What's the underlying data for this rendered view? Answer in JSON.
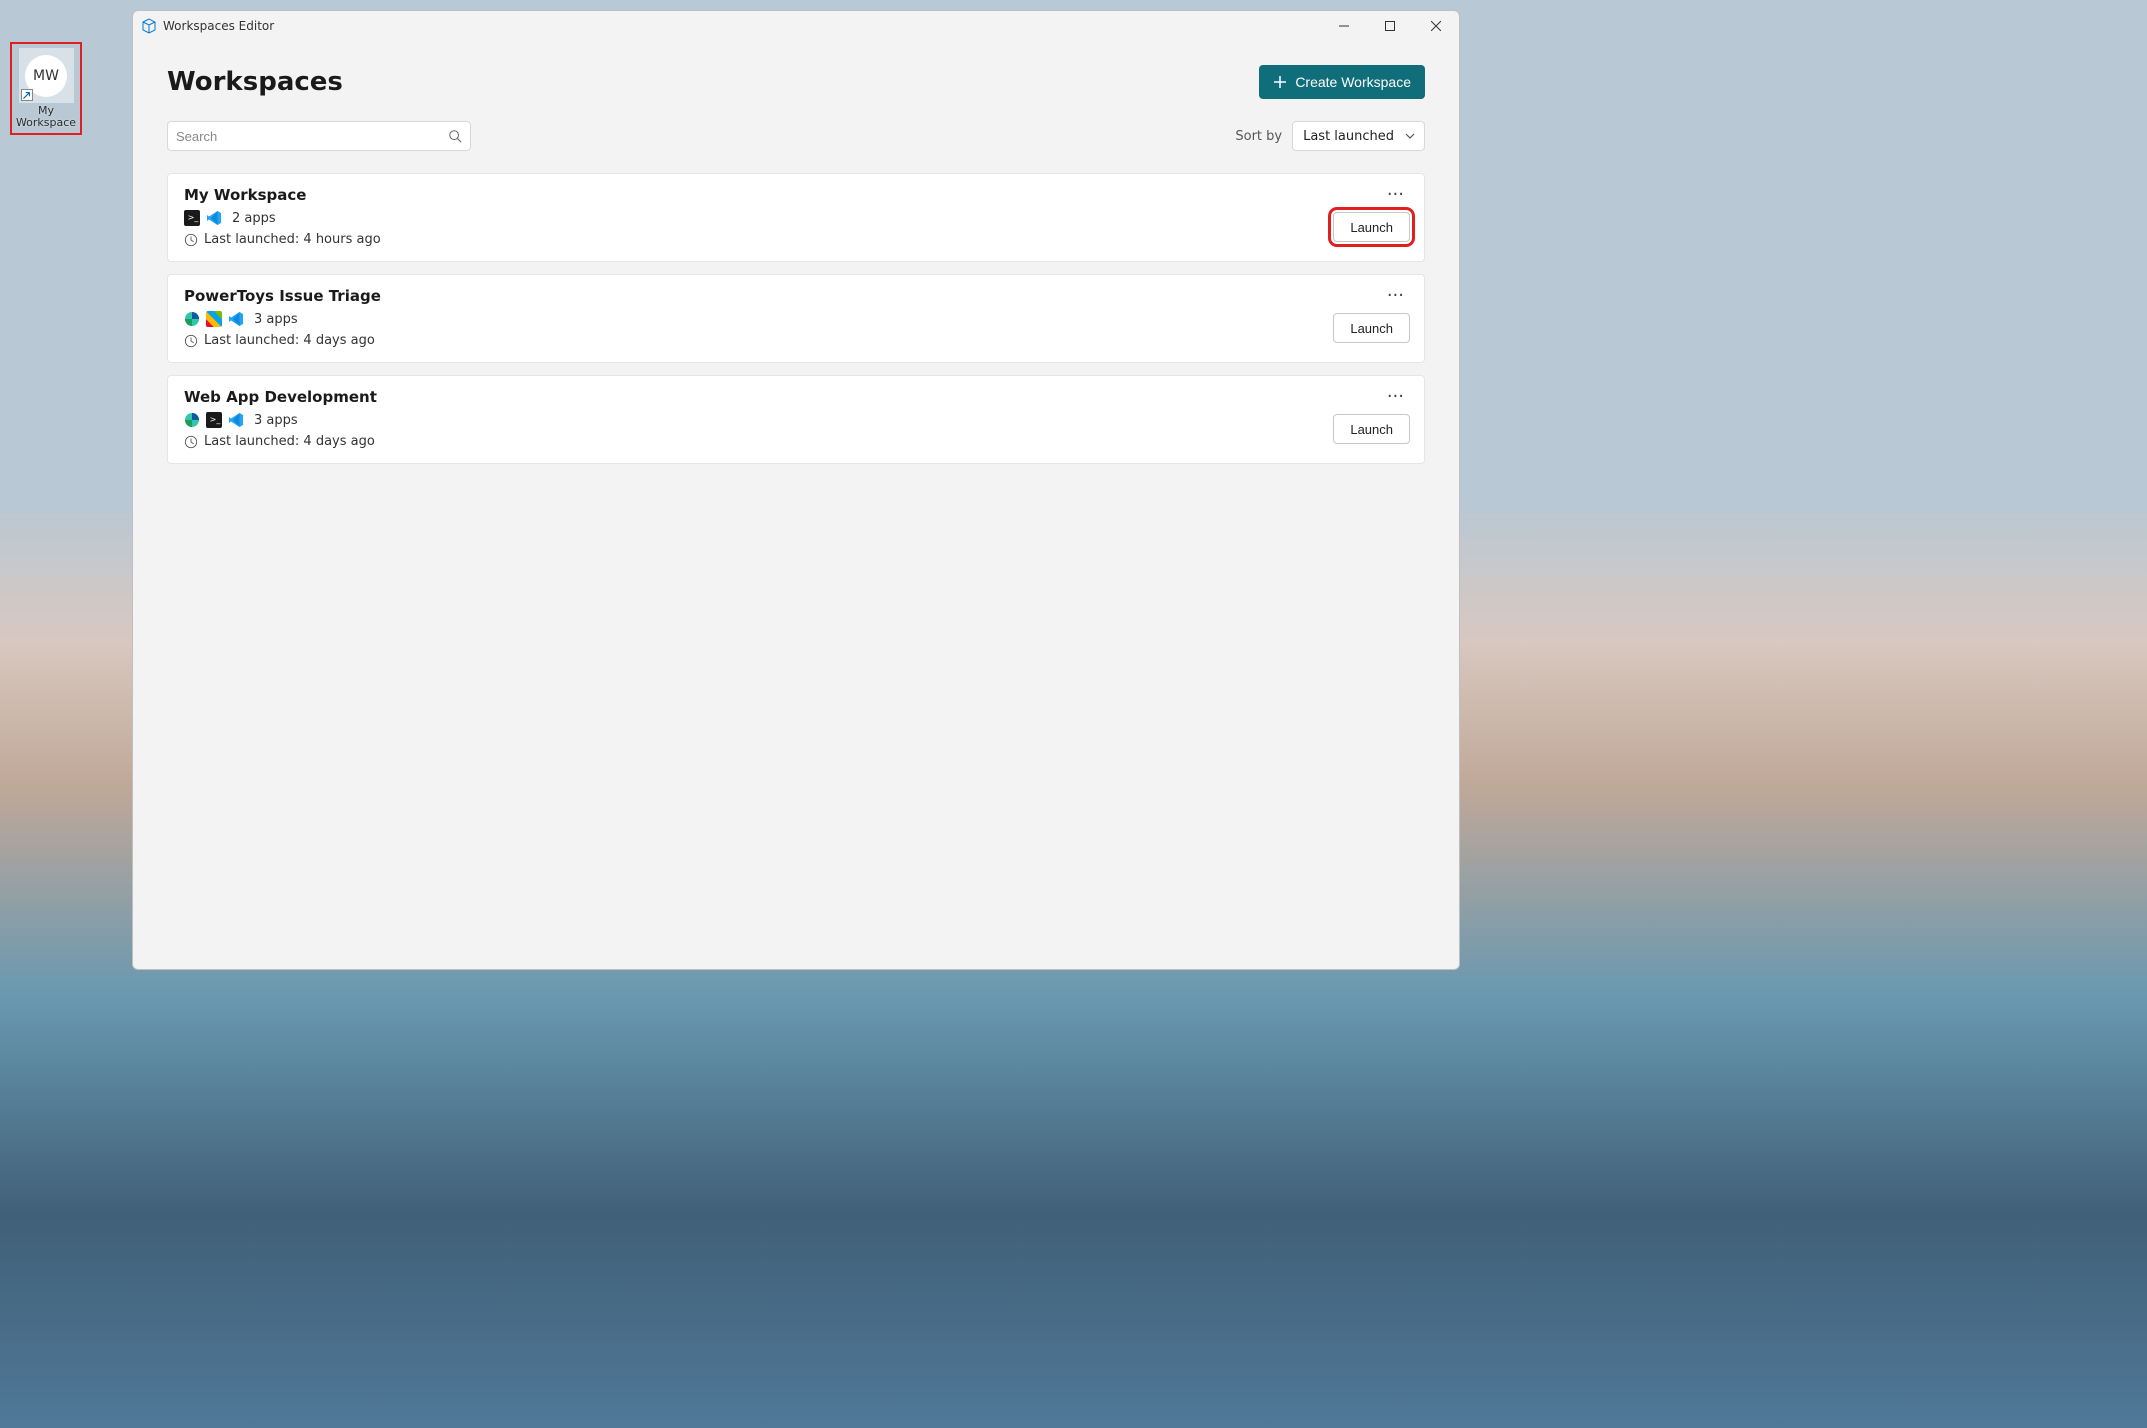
{
  "desktop": {
    "shortcut": {
      "initials": "MW",
      "label_line1": "My",
      "label_line2": "Workspace"
    }
  },
  "window": {
    "title": "Workspaces Editor"
  },
  "page": {
    "title": "Workspaces",
    "create_button": "Create Workspace"
  },
  "search": {
    "placeholder": "Search",
    "value": ""
  },
  "sort": {
    "label": "Sort by",
    "selected": "Last launched"
  },
  "workspaces": [
    {
      "name": "My Workspace",
      "apps_label": "2 apps",
      "last_launched": "Last launched: 4 hours ago",
      "launch_label": "Launch",
      "highlight_launch": true,
      "icons": [
        "terminal",
        "vscode"
      ]
    },
    {
      "name": "PowerToys Issue Triage",
      "apps_label": "3 apps",
      "last_launched": "Last launched: 4 days ago",
      "launch_label": "Launch",
      "highlight_launch": false,
      "icons": [
        "edge",
        "powertoys",
        "vscode"
      ]
    },
    {
      "name": "Web App Development",
      "apps_label": "3 apps",
      "last_launched": "Last launched: 4 days ago",
      "launch_label": "Launch",
      "highlight_launch": false,
      "icons": [
        "edge",
        "terminal",
        "vscode"
      ]
    }
  ]
}
